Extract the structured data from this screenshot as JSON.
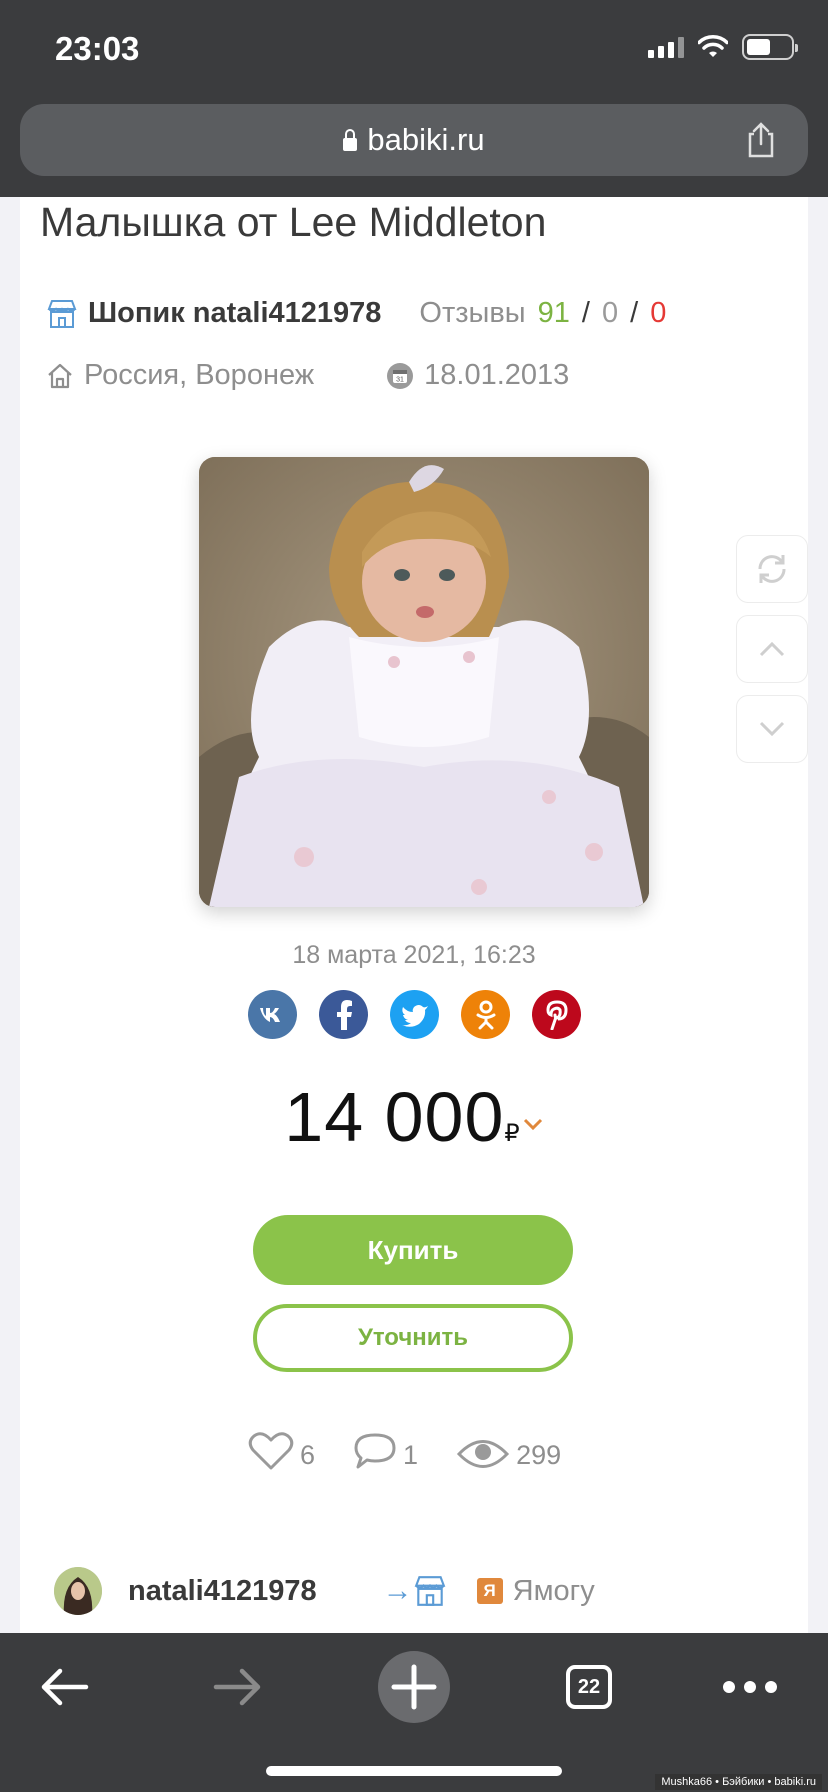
{
  "status_bar": {
    "time": "23:03"
  },
  "browser": {
    "url": "babiki.ru"
  },
  "listing": {
    "title": "Малышка от Lee Middleton",
    "shop_name": "Шопик natali4121978",
    "reviews_label": "Отзывы",
    "reviews_positive": "91",
    "reviews_neutral": "0",
    "reviews_negative": "0",
    "reviews_sep": "/",
    "location": "Россия, Воронеж",
    "date_published": "18.01.2013",
    "updated": "18 марта 2021, 16:23",
    "price": "14 000",
    "currency": "₽",
    "buy_label": "Купить",
    "ask_label": "Уточнить",
    "likes": "6",
    "comments": "1",
    "views": "299",
    "author": "natali4121978",
    "yamogu": "Ямогу",
    "yamogu_badge": "Я"
  },
  "social": [
    {
      "name": "vk-icon",
      "color": "#4a76a8"
    },
    {
      "name": "facebook-icon",
      "color": "#3b5998"
    },
    {
      "name": "twitter-icon",
      "color": "#1da1f2"
    },
    {
      "name": "odnoklassniki-icon",
      "color": "#ee8208"
    },
    {
      "name": "pinterest-icon",
      "color": "#bd081c"
    }
  ],
  "toolbar": {
    "tab_count": "22"
  },
  "watermark": "Mushka66 • Бэйбики • babiki.ru",
  "colors": {
    "accent_green": "#8bc34a",
    "negative_red": "#e53935",
    "bar_dark": "#3b3c3e"
  }
}
